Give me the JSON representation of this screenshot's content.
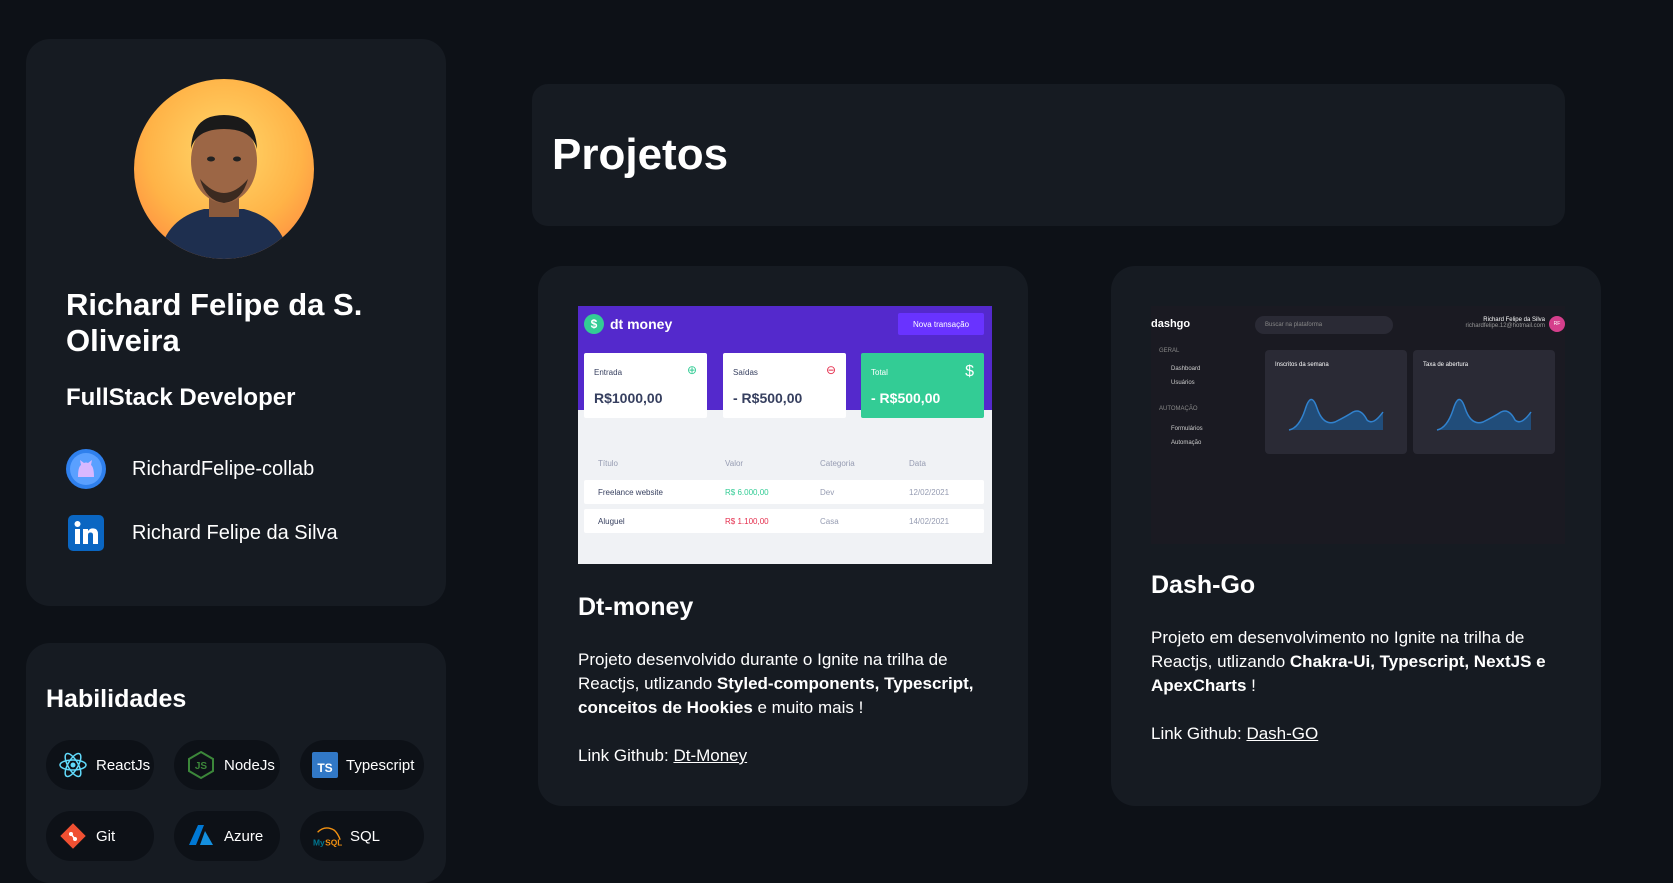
{
  "profile": {
    "name": "Richard Felipe da S. Oliveira",
    "role": "FullStack Developer",
    "github": "RichardFelipe-collab",
    "linkedin": "Richard Felipe da Silva"
  },
  "skills": {
    "title": "Habilidades",
    "items": [
      {
        "label": "ReactJs",
        "icon": "react-icon"
      },
      {
        "label": "NodeJs",
        "icon": "nodejs-icon"
      },
      {
        "label": "Typescript",
        "icon": "typescript-icon"
      },
      {
        "label": "Git",
        "icon": "git-icon"
      },
      {
        "label": "Azure",
        "icon": "azure-icon"
      },
      {
        "label": "SQL",
        "icon": "mysql-icon"
      }
    ]
  },
  "projects_header": {
    "title": "Projetos"
  },
  "projects": [
    {
      "title": "Dt-money",
      "desc_start": "Projeto desenvolvido durante o Ignite na trilha de Reactjs, utlizando ",
      "desc_bold": "Styled-components, Typescript, conceitos de Hookies",
      "desc_end": " e muito mais !",
      "link_label": "Link Github: ",
      "link_text": "Dt-Money",
      "thumb": {
        "app": "dt money",
        "button": "Nova transação",
        "cards": [
          {
            "label": "Entrada",
            "value": "R$1000,00"
          },
          {
            "label": "Saídas",
            "value": "- R$500,00"
          },
          {
            "label": "Total",
            "value": "- R$500,00"
          }
        ],
        "headers": [
          "Título",
          "Valor",
          "Categoria",
          "Data"
        ],
        "rows": [
          [
            "Freelance website",
            "R$ 6.000,00",
            "Dev",
            "12/02/2021"
          ],
          [
            "Aluguel",
            "R$ 1.100,00",
            "Casa",
            "14/02/2021"
          ]
        ]
      }
    },
    {
      "title": "Dash-Go",
      "desc_start": "Projeto em desenvolvimento no Ignite na trilha de Reactjs, utlizando ",
      "desc_bold": "Chakra-Ui, Typescript, NextJS e ApexCharts",
      "desc_end": " !",
      "link_label": "Link Github: ",
      "link_text": "Dash-GO",
      "thumb": {
        "app": "dashgo",
        "search": "Buscar na plataforma",
        "user_name": "Richard Felipe da Silva",
        "user_email": "richardfelipe.12@hotmail.com",
        "avatar_initials": "RF",
        "section_general": "GERAL",
        "nav_dashboard": "Dashboard",
        "nav_users": "Usuários",
        "section_automation": "AUTOMAÇÃO",
        "nav_forms": "Formulários",
        "nav_automation": "Automação",
        "panel1": "Inscritos da semana",
        "panel2": "Taxa de abertura"
      }
    }
  ],
  "colors": {
    "background": "#0d1117",
    "card": "#161b22",
    "dt_purple": "#5429cc",
    "dt_green": "#33cc95",
    "dt_red": "#e52e4d"
  }
}
